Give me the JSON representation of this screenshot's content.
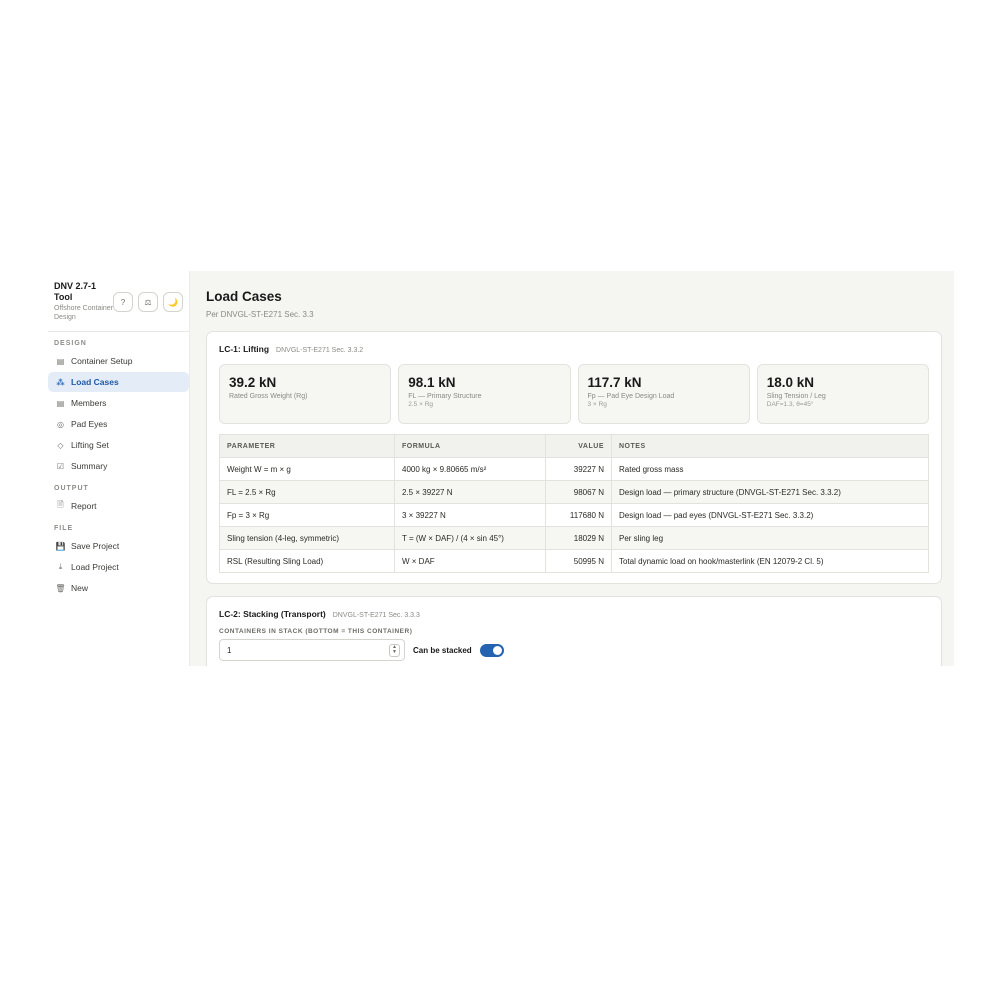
{
  "brand": {
    "title": "DNV 2.7-1 Tool",
    "subtitle": "Offshore Container Design",
    "buttons": [
      {
        "icon": "help-icon",
        "glyph": "?"
      },
      {
        "icon": "units-icon",
        "glyph": "⚖"
      },
      {
        "icon": "dark-mode-icon",
        "glyph": "🌙"
      }
    ]
  },
  "sidebar": {
    "design_label": "DESIGN",
    "design_items": [
      {
        "label": "Container Setup",
        "icon": "table-icon",
        "glyph": "▤"
      },
      {
        "label": "Load Cases",
        "icon": "loader-icon",
        "glyph": "⁂",
        "active": true
      },
      {
        "label": "Members",
        "icon": "table-icon",
        "glyph": "▤"
      },
      {
        "label": "Pad Eyes",
        "icon": "target-icon",
        "glyph": "◎"
      },
      {
        "label": "Lifting Set",
        "icon": "diamond-icon",
        "glyph": "◇"
      },
      {
        "label": "Summary",
        "icon": "checkbox-icon",
        "glyph": "☑"
      }
    ],
    "output_label": "OUTPUT",
    "output_items": [
      {
        "label": "Report",
        "icon": "document-icon",
        "glyph": "🗎"
      }
    ],
    "file_label": "FILE",
    "file_items": [
      {
        "label": "Save Project",
        "icon": "save-icon",
        "glyph": "💾"
      },
      {
        "label": "Load Project",
        "icon": "download-icon",
        "glyph": "⤓"
      },
      {
        "label": "New",
        "icon": "trash-icon",
        "glyph": "🗑"
      }
    ]
  },
  "page": {
    "title": "Load Cases",
    "subtitle": "Per DNVGL-ST-E271 Sec. 3.3"
  },
  "lc1": {
    "title": "LC-1: Lifting",
    "ref": "DNVGL-ST-E271 Sec. 3.3.2",
    "stats": [
      {
        "value": "39.2 kN",
        "label": "Rated Gross Weight (Rg)",
        "sub": ""
      },
      {
        "value": "98.1 kN",
        "label": "FL — Primary Structure",
        "sub": "2.5 × Rg"
      },
      {
        "value": "117.7 kN",
        "label": "Fp — Pad Eye Design Load",
        "sub": "3 × Rg"
      },
      {
        "value": "18.0 kN",
        "label": "Sling Tension / Leg",
        "sub": "DAF=1.3, θ=45°"
      }
    ],
    "table": {
      "headers": [
        "PARAMETER",
        "FORMULA",
        "VALUE",
        "NOTES"
      ],
      "rows": [
        [
          "Weight W = m × g",
          "4000 kg × 9.80665 m/s²",
          "39227 N",
          "Rated gross mass"
        ],
        [
          "FL = 2.5 × Rg",
          "2.5 × 39227 N",
          "98067 N",
          "Design load — primary structure (DNVGL-ST-E271 Sec. 3.3.2)"
        ],
        [
          "Fp = 3 × Rg",
          "3 × 39227 N",
          "117680 N",
          "Design load — pad eyes (DNVGL-ST-E271 Sec. 3.3.2)"
        ],
        [
          "Sling tension (4-leg, symmetric)",
          "T = (W × DAF) / (4 × sin 45°)",
          "18029 N",
          "Per sling leg"
        ],
        [
          "RSL (Resulting Sling Load)",
          "W × DAF",
          "50995 N",
          "Total dynamic load on hook/masterlink (EN 12079-2 Cl. 5)"
        ]
      ]
    }
  },
  "lc2": {
    "title": "LC-2: Stacking (Transport)",
    "ref": "DNVGL-ST-E271 Sec. 3.3.3",
    "field_label": "CONTAINERS IN STACK (BOTTOM = THIS CONTAINER)",
    "field_value": "1",
    "toggle_label": "Can be stacked",
    "toggle_on": true
  }
}
